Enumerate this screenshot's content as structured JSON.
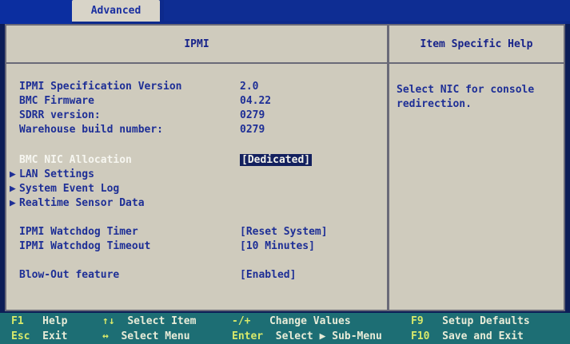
{
  "topbar": {
    "tab_label": "Advanced"
  },
  "panel": {
    "left_title": "IPMI",
    "right_title": "Item Specific Help"
  },
  "info": [
    {
      "label": "IPMI Specification Version",
      "value": "2.0"
    },
    {
      "label": "BMC Firmware",
      "value": "04.22"
    },
    {
      "label": "SDRR version:",
      "value": "0279"
    },
    {
      "label": "Warehouse build number:",
      "value": "0279"
    }
  ],
  "bmc_nic": {
    "label": "BMC NIC Allocation",
    "value": "[Dedicated]"
  },
  "submenus": [
    {
      "label": "LAN Settings"
    },
    {
      "label": "System Event Log"
    },
    {
      "label": "Realtime Sensor Data"
    }
  ],
  "watchdog": [
    {
      "label": "IPMI Watchdog Timer",
      "value": "[Reset System]"
    },
    {
      "label": "IPMI Watchdog Timeout",
      "value": "[10 Minutes]"
    }
  ],
  "blowout": {
    "label": "Blow-Out feature",
    "value": "[Enabled]"
  },
  "help": {
    "text": "Select NIC for console\nredirection."
  },
  "keys": [
    {
      "key": "F1",
      "desc": "Help"
    },
    {
      "key": "↑↓",
      "desc": "Select Item"
    },
    {
      "key": "-/+",
      "desc": "Change Values"
    },
    {
      "key": "F9",
      "desc": "Setup Defaults"
    },
    {
      "key": "Esc",
      "desc": "Exit"
    },
    {
      "key": "↔",
      "desc": "Select Menu"
    },
    {
      "key": "Enter",
      "desc": "Select ▶ Sub-Menu"
    },
    {
      "key": "F10",
      "desc": "Save and Exit"
    }
  ],
  "colors": {
    "background": "#0c1d57",
    "panel": "#cfcbbd",
    "text": "#1e2f96",
    "keybar": "#1d6e74",
    "key": "#d8e96a"
  }
}
